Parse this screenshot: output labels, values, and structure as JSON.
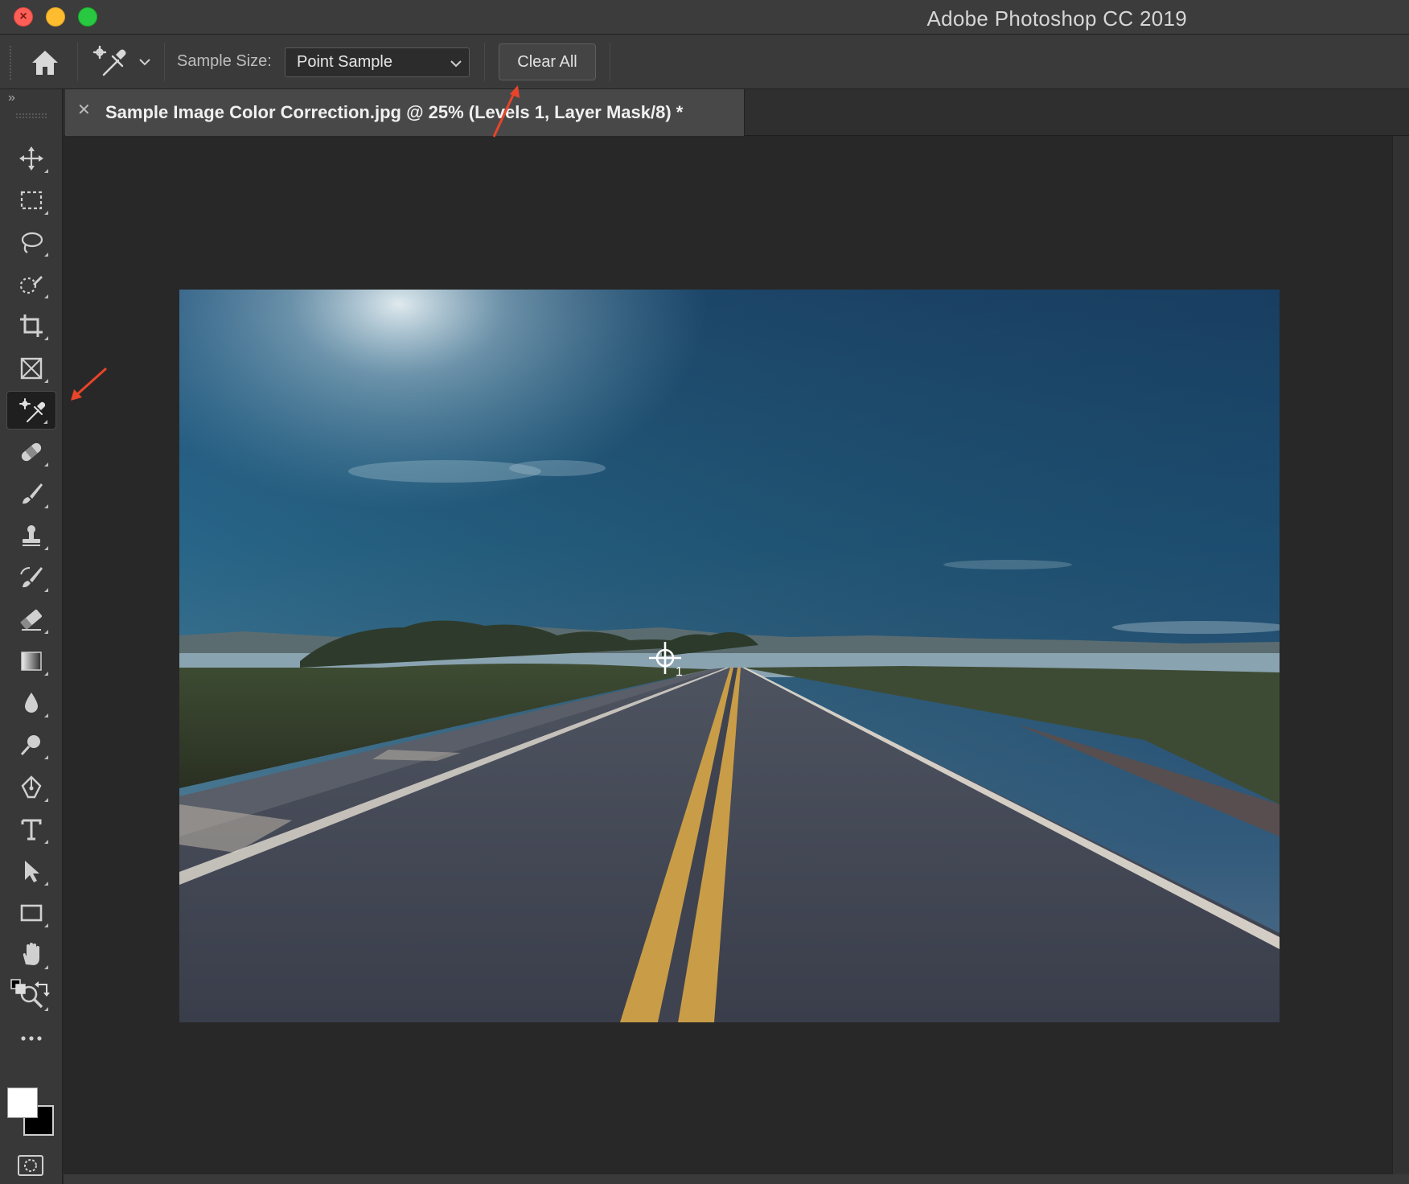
{
  "window": {
    "title": "Adobe Photoshop CC 2019"
  },
  "options_bar": {
    "sample_size_label": "Sample Size:",
    "sample_size_value": "Point Sample",
    "clear_all_label": "Clear All"
  },
  "document": {
    "tab_title": "Sample Image Color Correction.jpg @ 25% (Levels 1, Layer Mask/8) *",
    "tab_close_glyph": "✕",
    "sampler_label": "1"
  },
  "toolbar": {
    "collapse_glyph": "»",
    "tools": [
      {
        "name": "move-tool",
        "icon": "move-icon"
      },
      {
        "name": "rectangular-marquee-tool",
        "icon": "marquee-icon"
      },
      {
        "name": "lasso-tool",
        "icon": "lasso-icon"
      },
      {
        "name": "quick-selection-tool",
        "icon": "quick-selection-icon"
      },
      {
        "name": "crop-tool",
        "icon": "crop-icon"
      },
      {
        "name": "frame-tool",
        "icon": "frame-icon"
      },
      {
        "name": "color-sampler-tool",
        "icon": "color-sampler-icon",
        "active": true
      },
      {
        "name": "healing-brush-tool",
        "icon": "bandage-icon"
      },
      {
        "name": "brush-tool",
        "icon": "brush-icon"
      },
      {
        "name": "clone-stamp-tool",
        "icon": "stamp-icon"
      },
      {
        "name": "history-brush-tool",
        "icon": "history-brush-icon"
      },
      {
        "name": "eraser-tool",
        "icon": "eraser-icon"
      },
      {
        "name": "gradient-tool",
        "icon": "gradient-icon"
      },
      {
        "name": "blur-tool",
        "icon": "drop-icon"
      },
      {
        "name": "dodge-tool",
        "icon": "dodge-icon"
      },
      {
        "name": "pen-tool",
        "icon": "pen-icon"
      },
      {
        "name": "type-tool",
        "icon": "type-icon"
      },
      {
        "name": "path-selection-tool",
        "icon": "arrow-icon"
      },
      {
        "name": "rectangle-tool",
        "icon": "rectangle-icon"
      },
      {
        "name": "hand-tool",
        "icon": "hand-icon"
      },
      {
        "name": "zoom-tool",
        "icon": "zoom-icon"
      },
      {
        "name": "edit-toolbar",
        "icon": "more-icon"
      }
    ]
  },
  "colors": {
    "foreground": "#ffffff",
    "background": "#000000",
    "annotation_arrow": "#e8442a"
  }
}
